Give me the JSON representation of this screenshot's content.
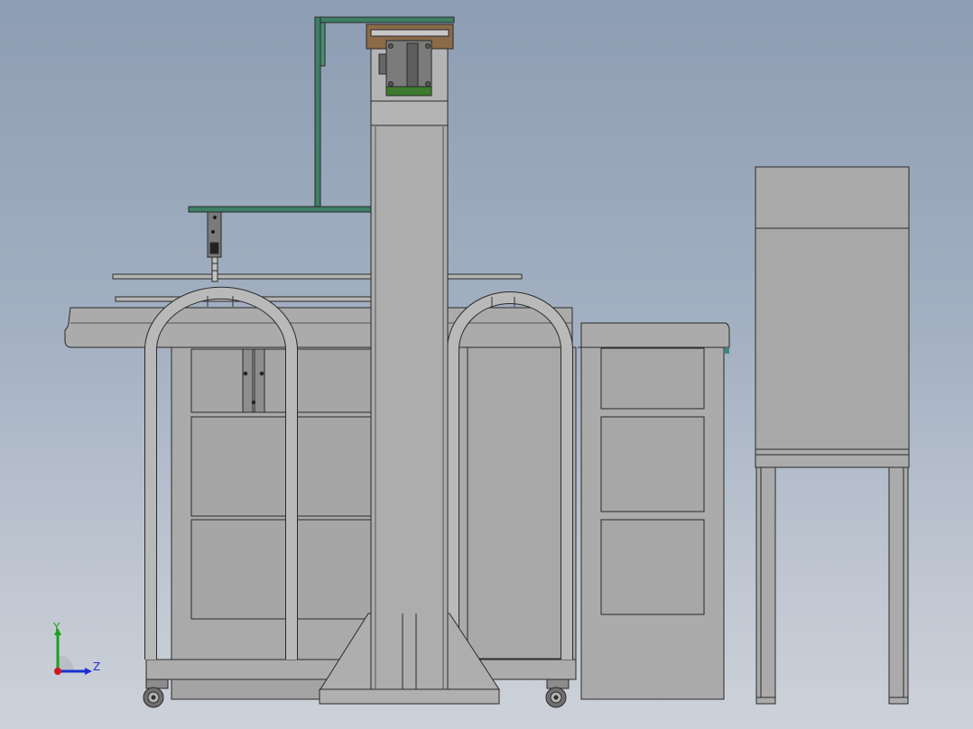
{
  "window": {
    "type": "CAD graphics viewport"
  },
  "triad": {
    "y_label": "Y",
    "z_label": "Z",
    "y_color": "#1aa01a",
    "z_color": "#1a2fd0",
    "x_color": "#d01a1a"
  },
  "colors": {
    "metal": "#a9a9a9",
    "metal_light": "#b7b7b7",
    "metal_dark": "#8f8f8f",
    "outline": "#2a2a2a",
    "green_arm": "#3f7f66",
    "bracket_brown": "#8a6a48",
    "motor_green": "#3d7a2e"
  }
}
